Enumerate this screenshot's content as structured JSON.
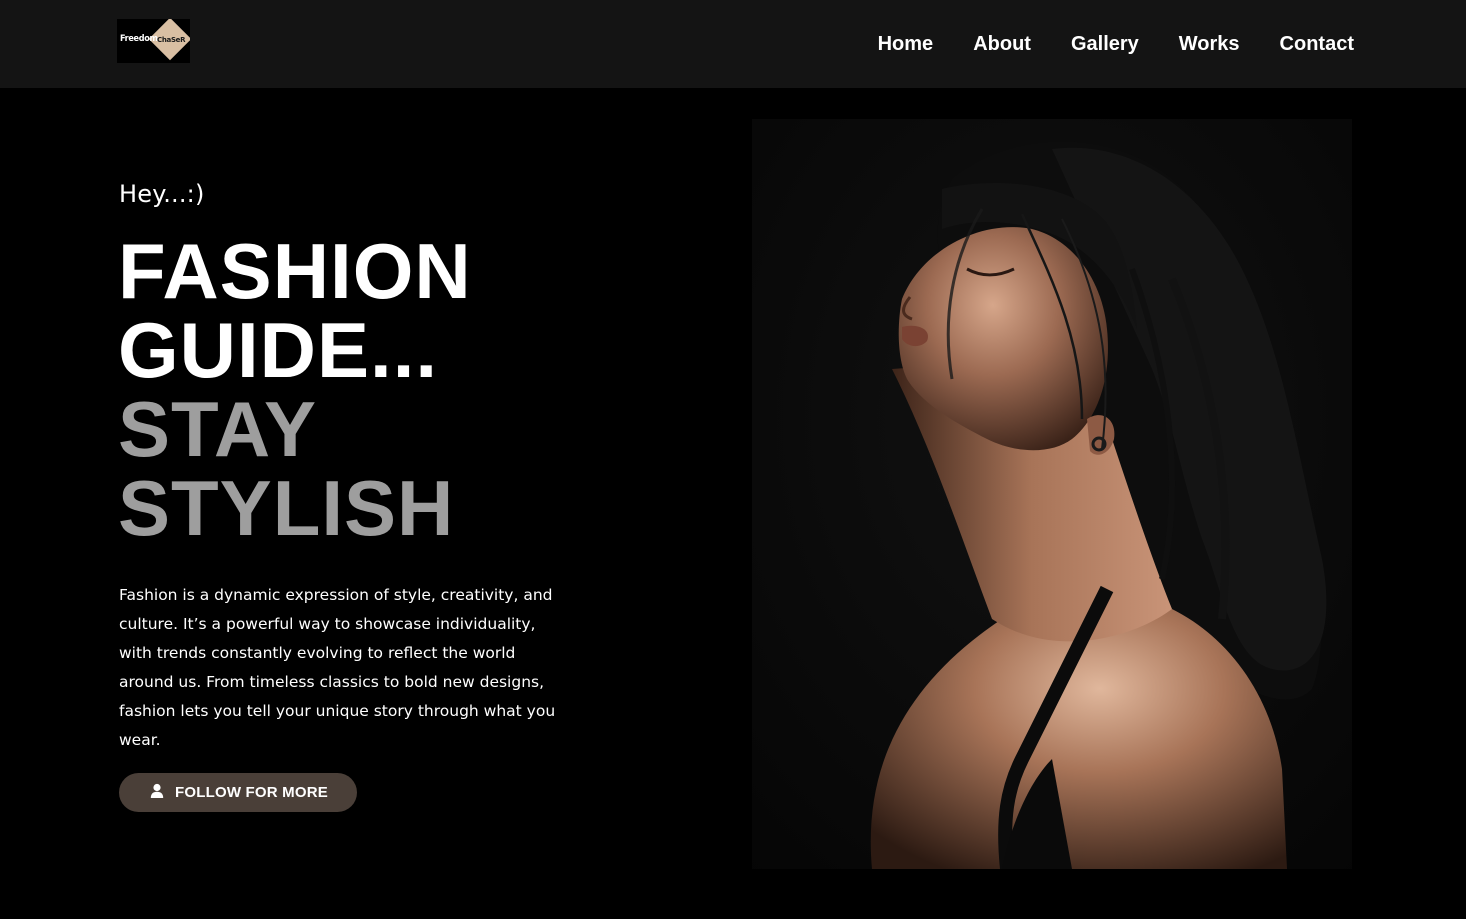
{
  "header": {
    "logo": {
      "text_primary": "Freedom",
      "text_secondary": "ChaSeR",
      "accent_color": "#d9bfa3"
    },
    "nav": [
      {
        "label": "Home"
      },
      {
        "label": "About"
      },
      {
        "label": "Gallery"
      },
      {
        "label": "Works"
      },
      {
        "label": "Contact"
      }
    ]
  },
  "hero": {
    "greeting": "Hey...:)",
    "headline_line1": "FASHION",
    "headline_line2": "GUIDE...",
    "headline_line3": "STAY",
    "headline_line4": "STYLISH",
    "description": "Fashion is a dynamic expression of style, creativity, and culture. It’s a powerful way to showcase individuality, with trends constantly evolving to reflect the world around us. From timeless classics to bold new designs, fashion lets you tell your unique story through what you wear.",
    "button": {
      "icon": "user-icon",
      "label": "FOLLOW FOR MORE"
    },
    "photo": {
      "icon": "portrait-photo"
    }
  },
  "colors": {
    "background": "#000000",
    "header_background": "#141414",
    "headline_white": "#ffffff",
    "headline_gray": "#9e9e9e",
    "button_background": "#4a3f38"
  }
}
